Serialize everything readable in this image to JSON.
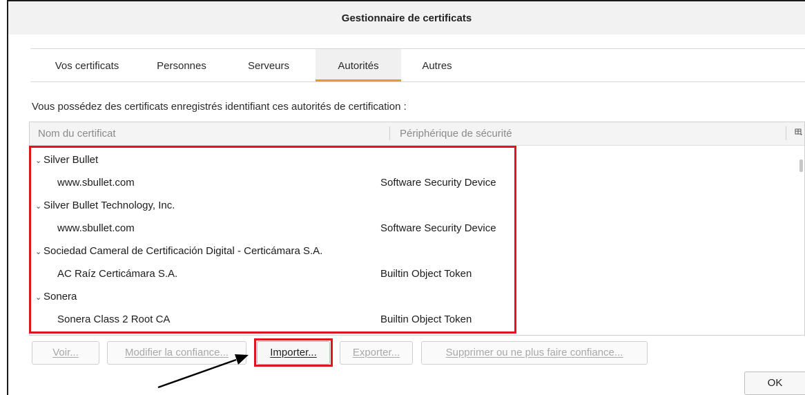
{
  "window": {
    "title": "Gestionnaire de certificats"
  },
  "tabs": [
    {
      "label": "Vos certificats",
      "selected": false
    },
    {
      "label": "Personnes",
      "selected": false
    },
    {
      "label": "Serveurs",
      "selected": false
    },
    {
      "label": "Autorités",
      "selected": true
    },
    {
      "label": "Autres",
      "selected": false
    }
  ],
  "intro_text": "Vous possédez des certificats enregistrés identifiant ces autorités de certification :",
  "table": {
    "columns": [
      "Nom du certificat",
      "Périphérique de sécurité"
    ],
    "column_picker_icon": "column-picker-icon",
    "rows": [
      {
        "name": "Silver Bullet",
        "device": "",
        "group": true
      },
      {
        "name": "www.sbullet.com",
        "device": "Software Security Device",
        "group": false
      },
      {
        "name": "Silver Bullet Technology, Inc.",
        "device": "",
        "group": true
      },
      {
        "name": "www.sbullet.com",
        "device": "Software Security Device",
        "group": false
      },
      {
        "name": "Sociedad Cameral de Certificación Digital - Certicámara S.A.",
        "device": "",
        "group": true
      },
      {
        "name": "AC Raíz Certicámara S.A.",
        "device": "Builtin Object Token",
        "group": false
      },
      {
        "name": "Sonera",
        "device": "",
        "group": true
      },
      {
        "name": "Sonera Class 2 Root CA",
        "device": "Builtin Object Token",
        "group": false
      }
    ],
    "expand_glyph": "⌄"
  },
  "buttons": {
    "view": "Voir...",
    "edit_trust": "Modifier la confiance...",
    "import": "Importer...",
    "export": "Exporter...",
    "delete": "Supprimer ou ne plus faire confiance..."
  },
  "ok": "OK",
  "colors": {
    "highlight": "#e2121e",
    "tab_accent": "#f0962a",
    "disabled_text": "#a8a8a8"
  }
}
